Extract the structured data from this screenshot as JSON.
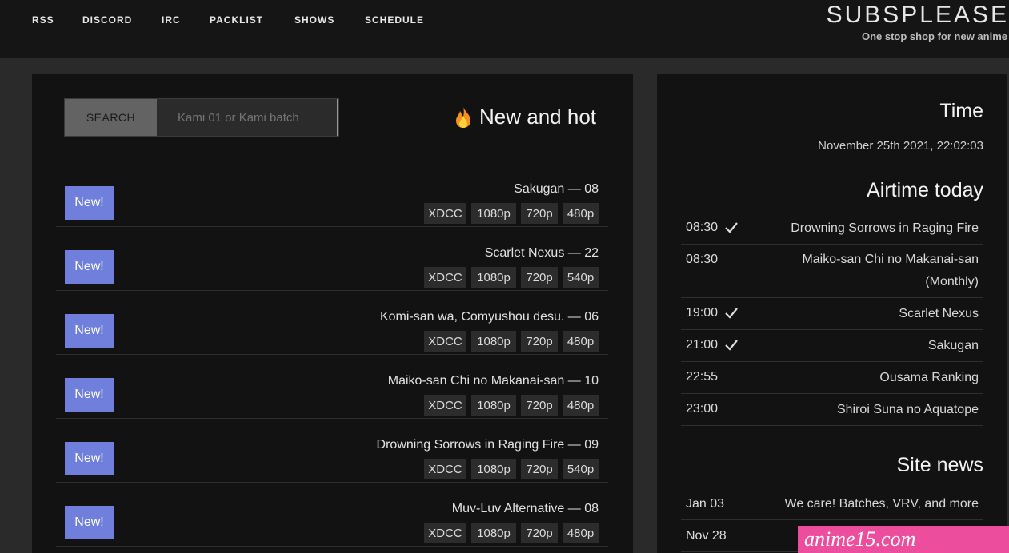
{
  "nav": {
    "items": [
      "RSS",
      "DISCORD",
      "IRC",
      "PACKLIST",
      "SHOWS",
      "SCHEDULE"
    ]
  },
  "brand": {
    "title": "SUBSPLEASE",
    "tagline": "One stop shop for new anime"
  },
  "search": {
    "button_label": "SEARCH",
    "placeholder": "Kami 01 or Kami batch"
  },
  "main": {
    "heading": "New and hot",
    "new_badge": "New!",
    "releases": [
      {
        "title": "Sakugan — 08",
        "qualities": [
          "480p",
          "720p",
          "1080p",
          "XDCC"
        ]
      },
      {
        "title": "Scarlet Nexus — 22",
        "qualities": [
          "540p",
          "720p",
          "1080p",
          "XDCC"
        ]
      },
      {
        "title": "Komi-san wa, Comyushou desu. — 06",
        "qualities": [
          "480p",
          "720p",
          "1080p",
          "XDCC"
        ]
      },
      {
        "title": "Maiko-san Chi no Makanai-san — 10",
        "qualities": [
          "480p",
          "720p",
          "1080p",
          "XDCC"
        ]
      },
      {
        "title": "Drowning Sorrows in Raging Fire — 09",
        "qualities": [
          "540p",
          "720p",
          "1080p",
          "XDCC"
        ]
      },
      {
        "title": "Muv-Luv Alternative — 08",
        "qualities": [
          "480p",
          "720p",
          "1080p",
          "XDCC"
        ]
      }
    ]
  },
  "sidebar": {
    "time_heading": "Time",
    "clock": "November 25th 2021, 22:02:03",
    "airtime_heading": "Airtime today",
    "airtime": [
      {
        "name": "Drowning Sorrows in Raging Fire",
        "time": "08:30",
        "aired": true
      },
      {
        "name": "Maiko-san Chi no Makanai-san (Monthly)",
        "time": "08:30",
        "aired": false
      },
      {
        "name": "Scarlet Nexus",
        "time": "19:00",
        "aired": true
      },
      {
        "name": "Sakugan",
        "time": "21:00",
        "aired": true
      },
      {
        "name": "Ousama Ranking",
        "time": "22:55",
        "aired": false
      },
      {
        "name": "Shiroi Suna no Aquatope",
        "time": "23:00",
        "aired": false
      }
    ],
    "news_heading": "Site news",
    "news": [
      {
        "title": "We care! Batches, VRV, and more",
        "date": "Jan 03"
      },
      {
        "title": "",
        "date": "Nov 28"
      }
    ]
  },
  "watermark": "anime15.com",
  "colors": {
    "accent": "#6f7fdb",
    "panel": "#121212",
    "background": "#2a2a2a",
    "watermark": "#ec4e9d"
  }
}
